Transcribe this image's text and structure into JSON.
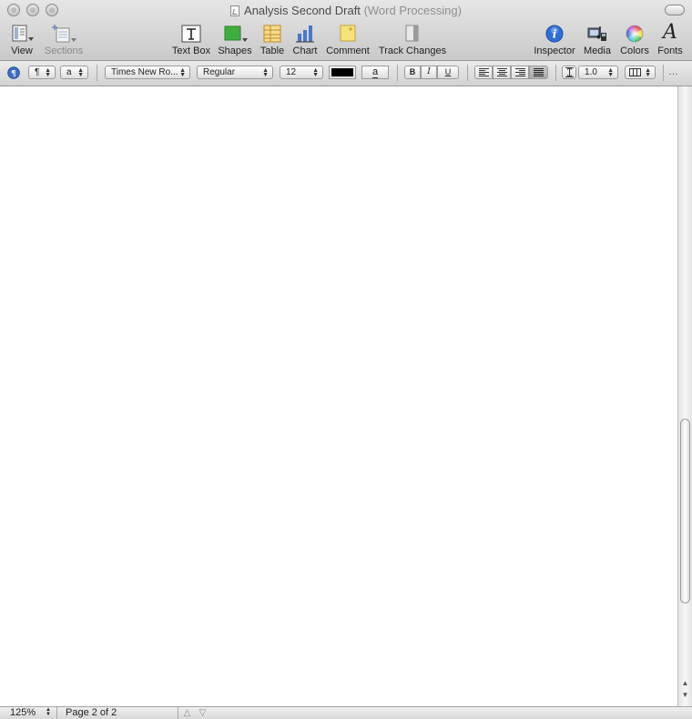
{
  "window": {
    "title": "Analysis Second Draft",
    "subtitle": "(Word Processing)"
  },
  "toolbar": {
    "view_label": "View",
    "sections_label": "Sections",
    "textbox_label": "Text Box",
    "shapes_label": "Shapes",
    "table_label": "Table",
    "chart_label": "Chart",
    "comment_label": "Comment",
    "track_changes_label": "Track Changes",
    "inspector_label": "Inspector",
    "media_label": "Media",
    "colors_label": "Colors",
    "fonts_label": "Fonts",
    "fonts_glyph": "A",
    "inspector_glyph": "i"
  },
  "format_bar": {
    "paragraph_style": "¶",
    "character_style": "a",
    "font_family": "Times New Ro...",
    "font_typeface": "Regular",
    "font_size": "12",
    "highlight_glyph": "a",
    "bold": "B",
    "italic": "I",
    "underline": "U",
    "line_spacing": "1.0",
    "overflow": "…"
  },
  "status_bar": {
    "zoom": "125%",
    "page_indicator": "Page 2 of 2"
  },
  "colors": {
    "text_color_swatch": "#000000",
    "shapes_green": "#3fae3f",
    "inspector_blue": "#2f6fd6",
    "comment_yellow": "#f6e27a",
    "table_orange": "#e9b64b",
    "chart_blue": "#4a78c8"
  }
}
